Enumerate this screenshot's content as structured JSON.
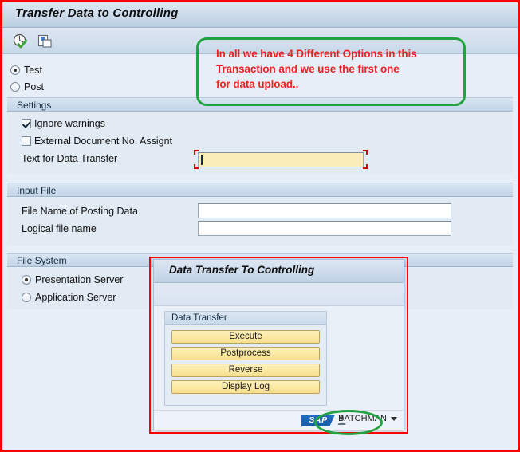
{
  "window": {
    "title": "Transfer Data to Controlling"
  },
  "toolbar": {
    "buttons": [
      {
        "name": "execute-check-icon",
        "tooltip": "Execute"
      },
      {
        "name": "copy-icon",
        "tooltip": "Multiple Selection"
      }
    ]
  },
  "mode_options": {
    "test_label": "Test",
    "post_label": "Post",
    "selected": "Test"
  },
  "annotation_callout": {
    "line1": "In all we have 4 Different Options in this",
    "line2": "Transaction and we use the first one",
    "line3": "for data upload..",
    "text_color": "#ee2222",
    "border_color": "#22a342"
  },
  "settings": {
    "header": "Settings",
    "ignore_warnings_label": "Ignore warnings",
    "ignore_warnings_checked": true,
    "external_doc_label": "External Document No. Assignt",
    "external_doc_checked": false,
    "text_transfer_label": "Text for Data Transfer",
    "text_transfer_value": "",
    "text_transfer_required": true
  },
  "input_file": {
    "header": "Input File",
    "file_name_label": "File Name of Posting Data",
    "file_name_value": "",
    "logical_name_label": "Logical file name",
    "logical_name_value": ""
  },
  "file_system": {
    "header": "File System",
    "presentation_label": "Presentation Server",
    "application_label": "Application Server",
    "selected": "Presentation Server"
  },
  "dialog": {
    "title": "Data Transfer To Controlling",
    "group_header": "Data Transfer",
    "buttons": [
      {
        "label": "Execute"
      },
      {
        "label": "Postprocess"
      },
      {
        "label": "Reverse"
      },
      {
        "label": "Display Log"
      }
    ],
    "footer": {
      "logo_text": "SAP",
      "user": "BATCHMAN"
    },
    "annotation_border_color": "#fe0000"
  },
  "colors": {
    "red_annotation": "#fe0000",
    "green_annotation": "#22a342",
    "required_field": "#fbeeb9",
    "button_yellow": "#fbe9a4",
    "panel_blue": "#e2eaf4"
  }
}
